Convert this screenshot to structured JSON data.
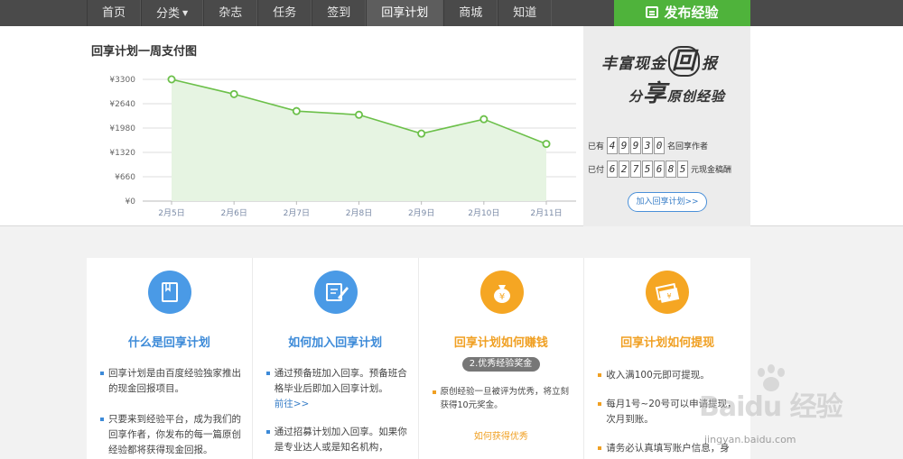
{
  "nav": {
    "items": [
      {
        "label": "首页",
        "active": false
      },
      {
        "label": "分类",
        "active": false,
        "dropdown": true
      },
      {
        "label": "杂志",
        "active": false
      },
      {
        "label": "任务",
        "active": false
      },
      {
        "label": "签到",
        "active": false
      },
      {
        "label": "回享计划",
        "active": true
      },
      {
        "label": "商城",
        "active": false
      },
      {
        "label": "知道",
        "active": false
      }
    ],
    "publish_label": "发布经验",
    "publish_color": "#4fb33b"
  },
  "chart_title": "回享计划一周支付图",
  "chart_data": {
    "type": "area",
    "categories": [
      "2月5日",
      "2月6日",
      "2月7日",
      "2月8日",
      "2月9日",
      "2月10日",
      "2月11日"
    ],
    "values": [
      3300,
      2900,
      2440,
      2340,
      1830,
      2220,
      1550
    ],
    "yticks": [
      "¥0",
      "¥660",
      "¥1320",
      "¥1980",
      "¥2640",
      "¥3300"
    ],
    "ylim": [
      0,
      3300
    ],
    "grid": true,
    "line_color": "#6cc04a",
    "fill_color": "#e6f4e2"
  },
  "banner": {
    "slogan_line1_a": "丰富现金",
    "slogan_line1_b": "回",
    "slogan_line1_c": "报",
    "slogan_line2_a": "分",
    "slogan_line2_b": "享",
    "slogan_line2_c": "原创经验",
    "authors_prefix": "已有",
    "authors_digits": [
      "4",
      "9",
      "9",
      "3",
      "0"
    ],
    "authors_suffix": "名回享作者",
    "paid_prefix": "已付",
    "paid_digits": [
      "6",
      "2",
      "7",
      "5",
      "6",
      "8",
      "5"
    ],
    "paid_suffix": "元现金稿酬",
    "join_label": "加入回享计划>>"
  },
  "cards": [
    {
      "title": "什么是回享计划",
      "bullets": [
        "回享计划是由百度经验独家推出的现金回报项目。",
        "只要来到经验平台，成为我们的回享作者，你发布的每一篇原创经验都将获得现金回报。"
      ]
    },
    {
      "title": "如何加入回享计划",
      "bullets": [
        "通过预备班加入回享。预备班合格毕业后即加入回享计划。",
        "通过招募计划加入回享。如果你是专业达人或是知名机构，"
      ],
      "link": "前往>>"
    },
    {
      "title": "回享计划如何赚钱",
      "badge": "2.优秀经验奖金",
      "bullets": [
        "原创经验一旦被评为优秀，将立刻获得10元奖金。"
      ],
      "link": "如何获得优秀"
    },
    {
      "title": "回享计划如何提现",
      "bullets": [
        "收入满100元即可提现。",
        "每月1号~20号可以申请提现，次月到账。",
        "请务必认真填写账户信息，身"
      ]
    }
  ],
  "watermark": {
    "text": "Baidu 经验",
    "url": "jingyan.baidu.com"
  }
}
